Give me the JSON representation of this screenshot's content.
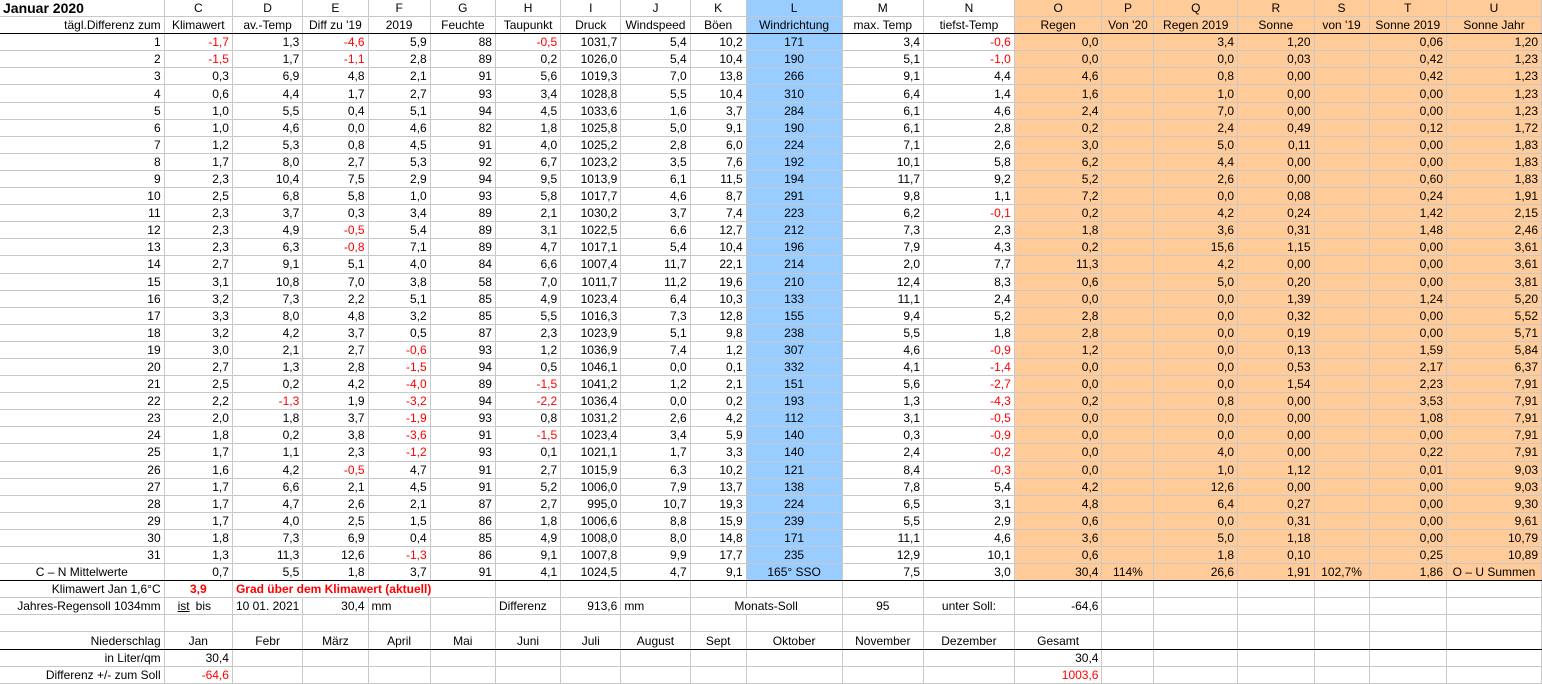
{
  "title": "Januar 2020",
  "col_letters": [
    "C",
    "D",
    "E",
    "F",
    "G",
    "H",
    "I",
    "J",
    "K",
    "L",
    "M",
    "N",
    "O",
    "P",
    "Q",
    "R",
    "S",
    "T",
    "U"
  ],
  "sub_headers": [
    "tägl.Differenz zum",
    "Klimawert",
    "av.-Temp",
    "Diff zu '19",
    "2019",
    "Feuchte",
    "Taupunkt",
    "Druck",
    "Windspeed",
    "Böen",
    "Windrichtung",
    "max. Temp",
    "tiefst-Temp",
    "Regen",
    "Von '20",
    "Regen 2019",
    "Sonne",
    "von '19",
    "Sonne 2019",
    "Sonne Jahr"
  ],
  "rows": [
    [
      "1",
      "-1,7",
      "1,3",
      "-4,6",
      "5,9",
      "88",
      "-0,5",
      "1031,7",
      "5,4",
      "10,2",
      "171",
      "3,4",
      "-0,6",
      "0,0",
      "",
      "3,4",
      "1,20",
      "",
      "0,06",
      "1,20"
    ],
    [
      "2",
      "-1,5",
      "1,7",
      "-1,1",
      "2,8",
      "89",
      "0,2",
      "1026,0",
      "5,4",
      "10,4",
      "190",
      "5,1",
      "-1,0",
      "0,0",
      "",
      "0,0",
      "0,03",
      "",
      "0,42",
      "1,23"
    ],
    [
      "3",
      "0,3",
      "6,9",
      "4,8",
      "2,1",
      "91",
      "5,6",
      "1019,3",
      "7,0",
      "13,8",
      "266",
      "9,1",
      "4,4",
      "4,6",
      "",
      "0,8",
      "0,00",
      "",
      "0,42",
      "1,23"
    ],
    [
      "4",
      "0,6",
      "4,4",
      "1,7",
      "2,7",
      "93",
      "3,4",
      "1028,8",
      "5,5",
      "10,4",
      "310",
      "6,4",
      "1,4",
      "1,6",
      "",
      "1,0",
      "0,00",
      "",
      "0,00",
      "1,23"
    ],
    [
      "5",
      "1,0",
      "5,5",
      "0,4",
      "5,1",
      "94",
      "4,5",
      "1033,6",
      "1,6",
      "3,7",
      "284",
      "6,1",
      "4,6",
      "2,4",
      "",
      "7,0",
      "0,00",
      "",
      "0,00",
      "1,23"
    ],
    [
      "6",
      "1,0",
      "4,6",
      "0,0",
      "4,6",
      "82",
      "1,8",
      "1025,8",
      "5,0",
      "9,1",
      "190",
      "6,1",
      "2,8",
      "0,2",
      "",
      "2,4",
      "0,49",
      "",
      "0,12",
      "1,72"
    ],
    [
      "7",
      "1,2",
      "5,3",
      "0,8",
      "4,5",
      "91",
      "4,0",
      "1025,2",
      "2,8",
      "6,0",
      "224",
      "7,1",
      "2,6",
      "3,0",
      "",
      "5,0",
      "0,11",
      "",
      "0,00",
      "1,83"
    ],
    [
      "8",
      "1,7",
      "8,0",
      "2,7",
      "5,3",
      "92",
      "6,7",
      "1023,2",
      "3,5",
      "7,6",
      "192",
      "10,1",
      "5,8",
      "6,2",
      "",
      "4,4",
      "0,00",
      "",
      "0,00",
      "1,83"
    ],
    [
      "9",
      "2,3",
      "10,4",
      "7,5",
      "2,9",
      "94",
      "9,5",
      "1013,9",
      "6,1",
      "11,5",
      "194",
      "11,7",
      "9,2",
      "5,2",
      "",
      "2,6",
      "0,00",
      "",
      "0,60",
      "1,83"
    ],
    [
      "10",
      "2,5",
      "6,8",
      "5,8",
      "1,0",
      "93",
      "5,8",
      "1017,7",
      "4,6",
      "8,7",
      "291",
      "9,8",
      "1,1",
      "7,2",
      "",
      "0,0",
      "0,08",
      "",
      "0,24",
      "1,91"
    ],
    [
      "11",
      "2,3",
      "3,7",
      "0,3",
      "3,4",
      "89",
      "2,1",
      "1030,2",
      "3,7",
      "7,4",
      "223",
      "6,2",
      "-0,1",
      "0,2",
      "",
      "4,2",
      "0,24",
      "",
      "1,42",
      "2,15"
    ],
    [
      "12",
      "2,3",
      "4,9",
      "-0,5",
      "5,4",
      "89",
      "3,1",
      "1022,5",
      "6,6",
      "12,7",
      "212",
      "7,3",
      "2,3",
      "1,8",
      "",
      "3,6",
      "0,31",
      "",
      "1,48",
      "2,46"
    ],
    [
      "13",
      "2,3",
      "6,3",
      "-0,8",
      "7,1",
      "89",
      "4,7",
      "1017,1",
      "5,4",
      "10,4",
      "196",
      "7,9",
      "4,3",
      "0,2",
      "",
      "15,6",
      "1,15",
      "",
      "0,00",
      "3,61"
    ],
    [
      "14",
      "2,7",
      "9,1",
      "5,1",
      "4,0",
      "84",
      "6,6",
      "1007,4",
      "11,7",
      "22,1",
      "214",
      "2,0",
      "7,7",
      "11,3",
      "",
      "4,2",
      "0,00",
      "",
      "0,00",
      "3,61"
    ],
    [
      "15",
      "3,1",
      "10,8",
      "7,0",
      "3,8",
      "58",
      "7,0",
      "1011,7",
      "11,2",
      "19,6",
      "210",
      "12,4",
      "8,3",
      "0,6",
      "",
      "5,0",
      "0,20",
      "",
      "0,00",
      "3,81"
    ],
    [
      "16",
      "3,2",
      "7,3",
      "2,2",
      "5,1",
      "85",
      "4,9",
      "1023,4",
      "6,4",
      "10,3",
      "133",
      "11,1",
      "2,4",
      "0,0",
      "",
      "0,0",
      "1,39",
      "",
      "1,24",
      "5,20"
    ],
    [
      "17",
      "3,3",
      "8,0",
      "4,8",
      "3,2",
      "85",
      "5,5",
      "1016,3",
      "7,3",
      "12,8",
      "155",
      "9,4",
      "5,2",
      "2,8",
      "",
      "0,0",
      "0,32",
      "",
      "0,00",
      "5,52"
    ],
    [
      "18",
      "3,2",
      "4,2",
      "3,7",
      "0,5",
      "87",
      "2,3",
      "1023,9",
      "5,1",
      "9,8",
      "238",
      "5,5",
      "1,8",
      "2,8",
      "",
      "0,0",
      "0,19",
      "",
      "0,00",
      "5,71"
    ],
    [
      "19",
      "3,0",
      "2,1",
      "2,7",
      "-0,6",
      "93",
      "1,2",
      "1036,9",
      "7,4",
      "1,2",
      "307",
      "4,6",
      "-0,9",
      "1,2",
      "",
      "0,0",
      "0,13",
      "",
      "1,59",
      "5,84"
    ],
    [
      "20",
      "2,7",
      "1,3",
      "2,8",
      "-1,5",
      "94",
      "0,5",
      "1046,1",
      "0,0",
      "0,1",
      "332",
      "4,1",
      "-1,4",
      "0,0",
      "",
      "0,0",
      "0,53",
      "",
      "2,17",
      "6,37"
    ],
    [
      "21",
      "2,5",
      "0,2",
      "4,2",
      "-4,0",
      "89",
      "-1,5",
      "1041,2",
      "1,2",
      "2,1",
      "151",
      "5,6",
      "-2,7",
      "0,0",
      "",
      "0,0",
      "1,54",
      "",
      "2,23",
      "7,91"
    ],
    [
      "22",
      "2,2",
      "-1,3",
      "1,9",
      "-3,2",
      "94",
      "-2,2",
      "1036,4",
      "0,0",
      "0,2",
      "193",
      "1,3",
      "-4,3",
      "0,2",
      "",
      "0,8",
      "0,00",
      "",
      "3,53",
      "7,91"
    ],
    [
      "23",
      "2,0",
      "1,8",
      "3,7",
      "-1,9",
      "93",
      "0,8",
      "1031,2",
      "2,6",
      "4,2",
      "112",
      "3,1",
      "-0,5",
      "0,0",
      "",
      "0,0",
      "0,00",
      "",
      "1,08",
      "7,91"
    ],
    [
      "24",
      "1,8",
      "0,2",
      "3,8",
      "-3,6",
      "91",
      "-1,5",
      "1023,4",
      "3,4",
      "5,9",
      "140",
      "0,3",
      "-0,9",
      "0,0",
      "",
      "0,0",
      "0,00",
      "",
      "0,00",
      "7,91"
    ],
    [
      "25",
      "1,7",
      "1,1",
      "2,3",
      "-1,2",
      "93",
      "0,1",
      "1021,1",
      "1,7",
      "3,3",
      "140",
      "2,4",
      "-0,2",
      "0,0",
      "",
      "4,0",
      "0,00",
      "",
      "0,22",
      "7,91"
    ],
    [
      "26",
      "1,6",
      "4,2",
      "-0,5",
      "4,7",
      "91",
      "2,7",
      "1015,9",
      "6,3",
      "10,2",
      "121",
      "8,4",
      "-0,3",
      "0,0",
      "",
      "1,0",
      "1,12",
      "",
      "0,01",
      "9,03"
    ],
    [
      "27",
      "1,7",
      "6,6",
      "2,1",
      "4,5",
      "91",
      "5,2",
      "1006,0",
      "7,9",
      "13,7",
      "138",
      "7,8",
      "5,4",
      "4,2",
      "",
      "12,6",
      "0,00",
      "",
      "0,00",
      "9,03"
    ],
    [
      "28",
      "1,7",
      "4,7",
      "2,6",
      "2,1",
      "87",
      "2,7",
      "995,0",
      "10,7",
      "19,3",
      "224",
      "6,5",
      "3,1",
      "4,8",
      "",
      "6,4",
      "0,27",
      "",
      "0,00",
      "9,30"
    ],
    [
      "29",
      "1,7",
      "4,0",
      "2,5",
      "1,5",
      "86",
      "1,8",
      "1006,6",
      "8,8",
      "15,9",
      "239",
      "5,5",
      "2,9",
      "0,6",
      "",
      "0,0",
      "0,31",
      "",
      "0,00",
      "9,61"
    ],
    [
      "30",
      "1,8",
      "7,3",
      "6,9",
      "0,4",
      "85",
      "4,9",
      "1008,0",
      "8,0",
      "14,8",
      "171",
      "11,1",
      "4,6",
      "3,6",
      "",
      "5,0",
      "1,18",
      "",
      "0,00",
      "10,79"
    ],
    [
      "31",
      "1,3",
      "11,3",
      "12,6",
      "-1,3",
      "86",
      "9,1",
      "1007,8",
      "9,9",
      "17,7",
      "235",
      "12,9",
      "10,1",
      "0,6",
      "",
      "1,8",
      "0,10",
      "",
      "0,25",
      "10,89"
    ]
  ],
  "avg_row": [
    "C – N Mittelwerte",
    "0,7",
    "5,5",
    "1,8",
    "3,7",
    "91",
    "4,1",
    "1024,5",
    "4,7",
    "9,1",
    "165° SSO",
    "7,5",
    "3,0",
    "30,4",
    "114%",
    "26,6",
    "1,91",
    "102,7%",
    "1,86",
    "O – U Summen"
  ],
  "klima": {
    "label": "Klimawert Jan 1,6°C",
    "value": "3,9",
    "text": "Grad über dem Klimawert (aktuell)"
  },
  "regen": {
    "label": "Jahres-Regensoll 1034mm",
    "ist": "ist",
    "bis": "bis",
    "date": "10 01. 2021",
    "value": "30,4",
    "unit1": "mm",
    "diff_label": "Differenz",
    "diff_value": "913,6",
    "unit2": "mm",
    "monats_label": "Monats-Soll",
    "monats_value": "95",
    "unter_label": "unter Soll:",
    "unter_value": "-64,6"
  },
  "months": {
    "label": "Niederschlag",
    "names": [
      "Jan",
      "Febr",
      "März",
      "April",
      "Mai",
      "Juni",
      "Juli",
      "August",
      "Sept",
      "Oktober",
      "November",
      "Dezember",
      "Gesamt"
    ]
  },
  "liter": {
    "label": "in Liter/qm",
    "jan": "30,4",
    "total": "30,4"
  },
  "differenz": {
    "label": "Differenz  +/- zum Soll",
    "jan": "-64,6",
    "total": "1003,6"
  },
  "colors": {
    "negative": "#ff0000",
    "wind_column": "#99ccff",
    "rain_sun_columns": "#ffcc99"
  }
}
